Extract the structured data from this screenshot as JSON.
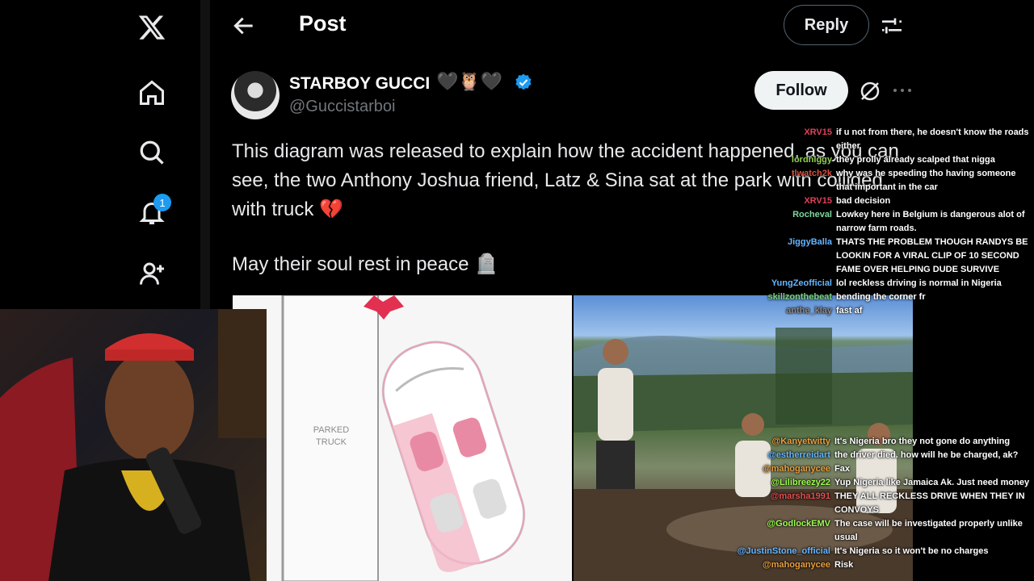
{
  "header": {
    "title": "Post",
    "reply_label": "Reply"
  },
  "nav": {
    "notification_count": "1"
  },
  "post": {
    "author_name": "STARBOY GUCCI",
    "emojis": "🖤🦉🖤",
    "handle": "@Guccistarboi",
    "follow_label": "Follow",
    "text": "This diagram was released to explain how the accident happened, as you can see, the two Anthony Joshua friend, Latz & Sina sat at the park with collided with truck 💔",
    "text2": "May their soul rest in peace 🪦"
  },
  "diagram": {
    "parked_label_1": "PARKED",
    "parked_label_2": "TRUCK"
  },
  "chat_top": [
    {
      "user": "XRV15",
      "msg": "if u not from there, he doesn't know the roads either",
      "color": "#e0415b"
    },
    {
      "user": "lordniggy",
      "msg": "they prolly already scalped that nigga",
      "color": "#8fd14f"
    },
    {
      "user": "tlwatch2k",
      "msg": "why was he speeding tho having someone that important in the car",
      "color": "#d94f3d"
    },
    {
      "user": "XRV15",
      "msg": "bad decision",
      "color": "#e0415b"
    },
    {
      "user": "Rocheval",
      "msg": "Lowkey here in Belgium is dangerous alot of narrow farm roads.",
      "color": "#7fd6a0"
    },
    {
      "user": "JiggyBalla",
      "msg": "THATS THE PROBLEM THOUGH RANDYS BE LOOKIN FOR A VIRAL CLIP OF 10 SECOND FAME OVER HELPING DUDE SURVIVE",
      "color": "#66b6ff"
    },
    {
      "user": "YungZeofficial",
      "msg": "lol reckless driving is normal in Nigeria",
      "color": "#66b6ff"
    },
    {
      "user": "skillzonthebeat",
      "msg": "bending the corner fr",
      "color": "#7bd17b"
    },
    {
      "user": "anthe_klay",
      "msg": "fast af",
      "color": "#8a8a8a"
    }
  ],
  "chat_bottom": [
    {
      "user": "@Kanyetwitty",
      "msg": "It's Nigeria bro they not gone do anything",
      "color": "#e9a040"
    },
    {
      "user": "@estherreidart",
      "msg": "the driver died. how will he be charged, ak?",
      "color": "#66b6ff"
    },
    {
      "user": "@mahoganycee",
      "msg": "Fax",
      "color": "#e9a040"
    },
    {
      "user": "@Lilibreezy22",
      "msg": "Yup Nigeria like Jamaica Ak. Just need money",
      "color": "#9cff4f"
    },
    {
      "user": "@marsha1991",
      "msg": "THEY ALL RECKLESS DRIVE WHEN THEY IN CONVOYS",
      "color": "#e05050"
    },
    {
      "user": "@GodlockEMV",
      "msg": "The case will be investigated properly unlike usual",
      "color": "#9cff4f"
    },
    {
      "user": "@JustinStone_official",
      "msg": "It's Nigeria so it won't be no charges",
      "color": "#66b6ff"
    },
    {
      "user": "@mahoganycee",
      "msg": "Risk",
      "color": "#e9a040"
    }
  ]
}
